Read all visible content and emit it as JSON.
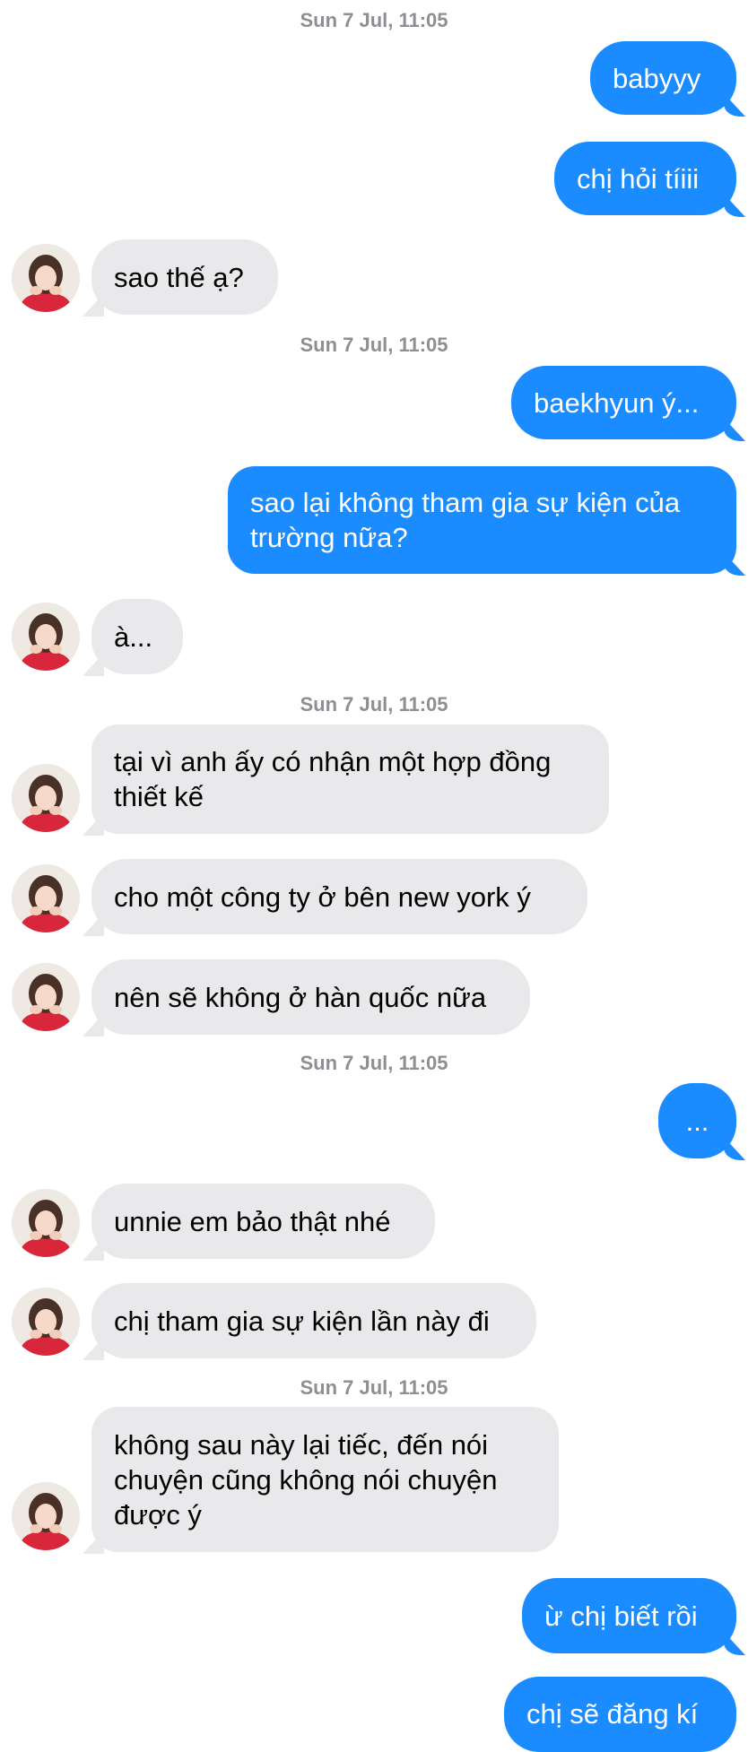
{
  "conversation": {
    "timestamps": [
      "Sun 7 Jul, 11:05",
      "Sun 7 Jul, 11:05",
      "Sun 7 Jul, 11:05",
      "Sun 7 Jul, 11:05",
      "Sun 7 Jul, 11:05"
    ],
    "messages": [
      {
        "direction": "outgoing",
        "lines": [
          "babyyy"
        ]
      },
      {
        "direction": "outgoing",
        "lines": [
          "chị hỏi tíiii"
        ]
      },
      {
        "direction": "incoming",
        "lines": [
          "sao thế ạ?"
        ]
      },
      {
        "direction": "outgoing",
        "lines": [
          "baekhyun ý..."
        ]
      },
      {
        "direction": "outgoing",
        "lines": [
          "sao lại không tham gia sự kiện của",
          "trường nữa?"
        ]
      },
      {
        "direction": "incoming",
        "lines": [
          "à..."
        ]
      },
      {
        "direction": "incoming",
        "lines": [
          "tại vì anh ấy có nhận một hợp đồng",
          "thiết kế"
        ]
      },
      {
        "direction": "incoming",
        "lines": [
          "cho một công ty ở bên new york ý"
        ]
      },
      {
        "direction": "incoming",
        "lines": [
          "nên sẽ không ở hàn quốc nữa"
        ]
      },
      {
        "direction": "outgoing",
        "lines": [
          "..."
        ]
      },
      {
        "direction": "incoming",
        "lines": [
          "unnie em bảo thật nhé"
        ]
      },
      {
        "direction": "incoming",
        "lines": [
          "chị tham gia sự kiện lần này đi"
        ]
      },
      {
        "direction": "incoming",
        "lines": [
          "không sau này lại tiếc, đến nói",
          "chuyện cũng không nói chuyện",
          "được ý"
        ]
      },
      {
        "direction": "outgoing",
        "lines": [
          "ừ chị biết rồi"
        ]
      },
      {
        "direction": "outgoing",
        "lines": [
          "chị sẽ đăng kí"
        ]
      }
    ]
  },
  "colors": {
    "outgoing_bubble": "#1a8cff",
    "incoming_bubble": "#e9e9eb",
    "timestamp_text": "#8e8e93",
    "background": "#ffffff"
  },
  "icons": {
    "avatar": "contact-avatar-photo"
  }
}
